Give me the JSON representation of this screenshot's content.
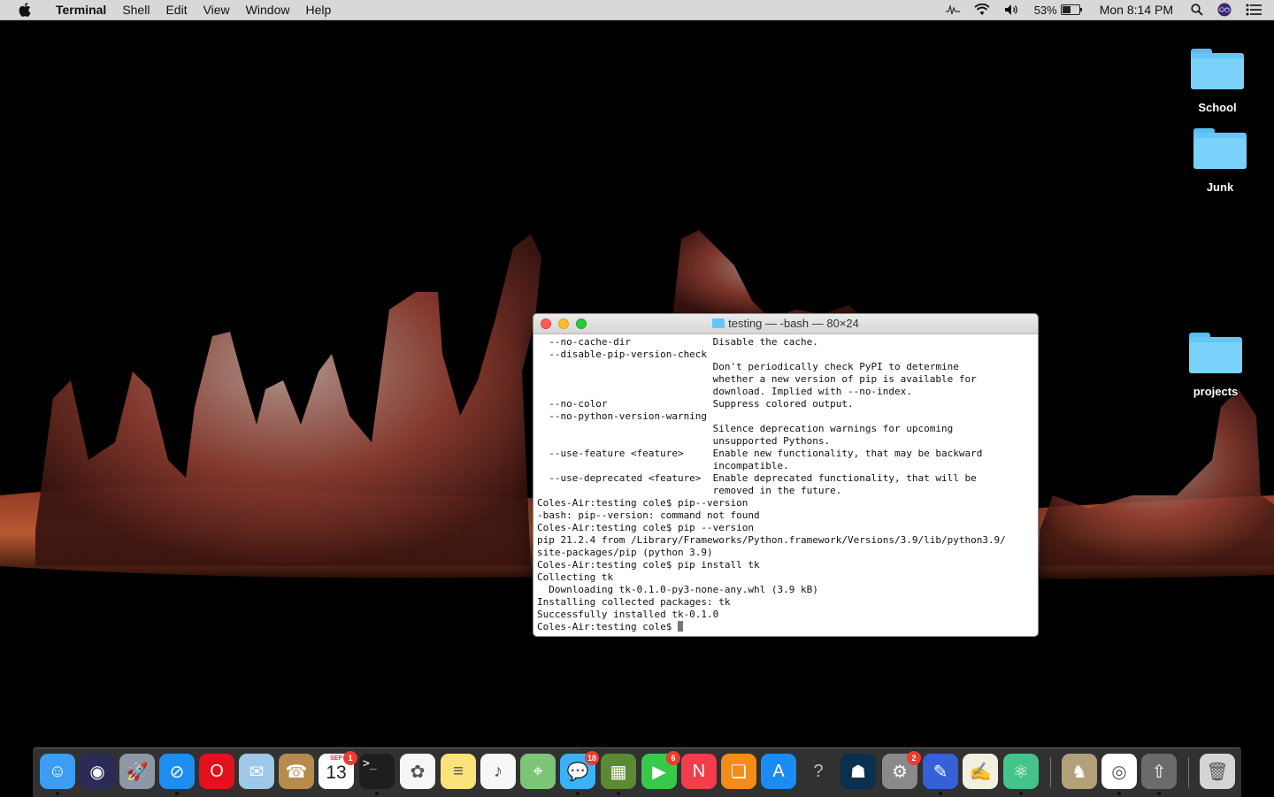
{
  "menubar": {
    "app_name": "Terminal",
    "menus": [
      "Shell",
      "Edit",
      "View",
      "Window",
      "Help"
    ],
    "battery_percent": "53%",
    "battery_level": 0.53,
    "clock": "Mon 8:14 PM"
  },
  "desktop": {
    "icons": [
      {
        "label": "School",
        "icon": "folder-icon"
      },
      {
        "label": "Junk",
        "icon": "folder-icon"
      },
      {
        "label": "projects",
        "icon": "folder-icon"
      }
    ]
  },
  "terminal": {
    "title": "testing — -bash — 80×24",
    "lines": [
      "  --no-cache-dir              Disable the cache.",
      "  --disable-pip-version-check",
      "                              Don't periodically check PyPI to determine",
      "                              whether a new version of pip is available for",
      "                              download. Implied with --no-index.",
      "  --no-color                  Suppress colored output.",
      "  --no-python-version-warning",
      "                              Silence deprecation warnings for upcoming",
      "                              unsupported Pythons.",
      "  --use-feature <feature>     Enable new functionality, that may be backward",
      "                              incompatible.",
      "  --use-deprecated <feature>  Enable deprecated functionality, that will be",
      "                              removed in the future.",
      "Coles-Air:testing cole$ pip--version",
      "-bash: pip--version: command not found",
      "Coles-Air:testing cole$ pip --version",
      "pip 21.2.4 from /Library/Frameworks/Python.framework/Versions/3.9/lib/python3.9/",
      "site-packages/pip (python 3.9)",
      "Coles-Air:testing cole$ pip install tk",
      "Collecting tk",
      "  Downloading tk-0.1.0-py3-none-any.whl (3.9 kB)",
      "Installing collected packages: tk",
      "Successfully installed tk-0.1.0"
    ],
    "prompt": "Coles-Air:testing cole$ "
  },
  "dock": {
    "calendar_month": "SEP",
    "calendar_day": "13",
    "items": [
      {
        "name": "finder-icon",
        "color": "#3d9df3",
        "badge": ""
      },
      {
        "name": "siri-icon",
        "color": "#2b2b58",
        "badge": ""
      },
      {
        "name": "launchpad-icon",
        "color": "#8d98a6",
        "badge": ""
      },
      {
        "name": "safari-icon",
        "color": "#1d8ef0",
        "badge": ""
      },
      {
        "name": "opera-icon",
        "color": "#e3101e",
        "badge": ""
      },
      {
        "name": "mail-icon",
        "color": "#9ec8e8",
        "badge": ""
      },
      {
        "name": "contacts-icon",
        "color": "#b68b4c",
        "badge": ""
      },
      {
        "name": "calendar-icon",
        "color": "#ffffff",
        "badge": "1"
      },
      {
        "name": "terminal-icon",
        "color": "#1e1e1e",
        "badge": ""
      },
      {
        "name": "photos-icon",
        "color": "#f6f6f6",
        "badge": ""
      },
      {
        "name": "notes-icon",
        "color": "#fbe27a",
        "badge": ""
      },
      {
        "name": "music-icon",
        "color": "#f7f7f7",
        "badge": ""
      },
      {
        "name": "maps-icon",
        "color": "#7cc576",
        "badge": ""
      },
      {
        "name": "messages-icon",
        "color": "#3bb2f6",
        "badge": "18"
      },
      {
        "name": "minecraft-icon",
        "color": "#5b8a33",
        "badge": ""
      },
      {
        "name": "facetime-icon",
        "color": "#37c949",
        "badge": "6"
      },
      {
        "name": "news-icon",
        "color": "#f33d4b",
        "badge": ""
      },
      {
        "name": "books-icon",
        "color": "#f58c17",
        "badge": ""
      },
      {
        "name": "app-store-icon",
        "color": "#1b8cf4",
        "badge": ""
      },
      {
        "name": "help-icon",
        "color": "#555555",
        "badge": ""
      },
      {
        "name": "kindle-icon",
        "color": "#0a2f4f",
        "badge": ""
      },
      {
        "name": "system-preferences-icon",
        "color": "#8a8a8a",
        "badge": "2"
      },
      {
        "name": "script-editor-icon",
        "color": "#3560d8",
        "badge": ""
      },
      {
        "name": "textedit-icon",
        "color": "#f4f0e0",
        "badge": ""
      },
      {
        "name": "atom-icon",
        "color": "#44c48a",
        "badge": ""
      },
      {
        "name": "chess-icon",
        "color": "#b1a07a",
        "badge": ""
      },
      {
        "name": "chrome-icon",
        "color": "#ffffff",
        "badge": ""
      },
      {
        "name": "rocket-icon",
        "color": "#6b6b6b",
        "badge": ""
      },
      {
        "name": "trash-icon",
        "color": "#d4d4d4",
        "badge": ""
      }
    ]
  }
}
